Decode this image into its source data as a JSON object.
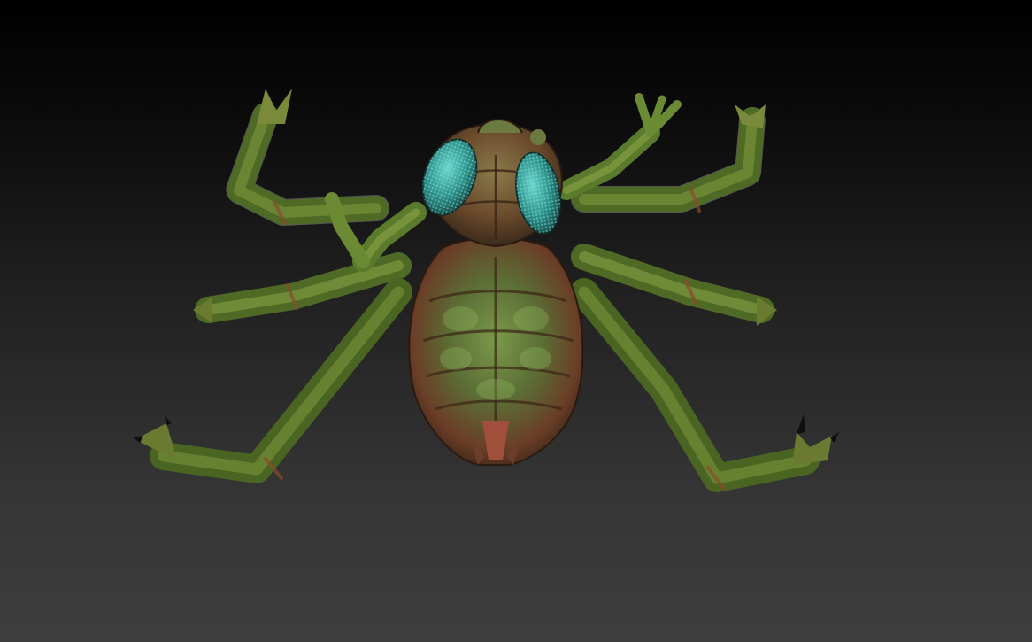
{
  "viewport": {
    "background_top": "#000000",
    "background_bottom": "#3e3e3e"
  },
  "model": {
    "icon": "spider-creature-sculpt",
    "colors": {
      "skin_green": "#5a7a2c",
      "skin_dark": "#3d5a1c",
      "flesh_red": "#8a4a2e",
      "eye_teal": "#3aa5a0",
      "claw_black": "#0e0e0e",
      "hair": "#cfcfcf"
    }
  }
}
